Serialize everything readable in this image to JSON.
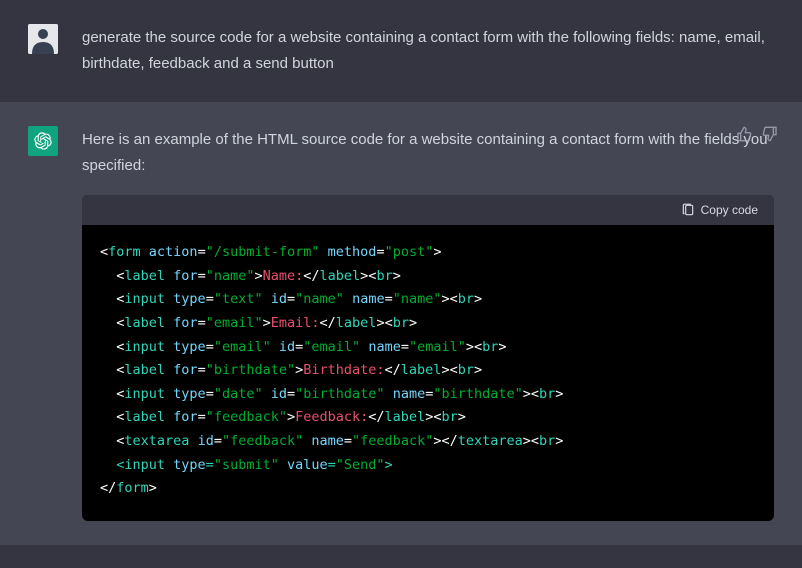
{
  "user": {
    "text": "generate the source code for a website containing a contact form with the following fields: name, email, birthdate, feedback and a send button"
  },
  "assistant": {
    "intro": "Here is an example of the HTML source code for a website containing a contact form with the fields you specified:",
    "copy_label": "Copy code",
    "code_tokens": [
      [
        [
          "punc",
          "<"
        ],
        [
          "tag",
          "form"
        ],
        [
          "punc",
          " "
        ],
        [
          "attr",
          "action"
        ],
        [
          "punc",
          "="
        ],
        [
          "str",
          "\"/submit-form\""
        ],
        [
          "punc",
          " "
        ],
        [
          "attr",
          "method"
        ],
        [
          "punc",
          "="
        ],
        [
          "str",
          "\"post\""
        ],
        [
          "punc",
          ">"
        ]
      ],
      [
        [
          "punc",
          "  <"
        ],
        [
          "tag",
          "label"
        ],
        [
          "punc",
          " "
        ],
        [
          "attr",
          "for"
        ],
        [
          "punc",
          "="
        ],
        [
          "str",
          "\"name\""
        ],
        [
          "punc",
          ">"
        ],
        [
          "text",
          "Name:"
        ],
        [
          "punc",
          "</"
        ],
        [
          "tag",
          "label"
        ],
        [
          "punc",
          "><"
        ],
        [
          "tag",
          "br"
        ],
        [
          "punc",
          ">"
        ]
      ],
      [
        [
          "punc",
          "  <"
        ],
        [
          "tag",
          "input"
        ],
        [
          "punc",
          " "
        ],
        [
          "attr",
          "type"
        ],
        [
          "punc",
          "="
        ],
        [
          "str",
          "\"text\""
        ],
        [
          "punc",
          " "
        ],
        [
          "attr",
          "id"
        ],
        [
          "punc",
          "="
        ],
        [
          "str",
          "\"name\""
        ],
        [
          "punc",
          " "
        ],
        [
          "attr",
          "name"
        ],
        [
          "punc",
          "="
        ],
        [
          "str",
          "\"name\""
        ],
        [
          "punc",
          "><"
        ],
        [
          "tag",
          "br"
        ],
        [
          "punc",
          ">"
        ]
      ],
      [
        [
          "punc",
          "  <"
        ],
        [
          "tag",
          "label"
        ],
        [
          "punc",
          " "
        ],
        [
          "attr",
          "for"
        ],
        [
          "punc",
          "="
        ],
        [
          "str",
          "\"email\""
        ],
        [
          "punc",
          ">"
        ],
        [
          "text",
          "Email:"
        ],
        [
          "punc",
          "</"
        ],
        [
          "tag",
          "label"
        ],
        [
          "punc",
          "><"
        ],
        [
          "tag",
          "br"
        ],
        [
          "punc",
          ">"
        ]
      ],
      [
        [
          "punc",
          "  <"
        ],
        [
          "tag",
          "input"
        ],
        [
          "punc",
          " "
        ],
        [
          "attr",
          "type"
        ],
        [
          "punc",
          "="
        ],
        [
          "str",
          "\"email\""
        ],
        [
          "punc",
          " "
        ],
        [
          "attr",
          "id"
        ],
        [
          "punc",
          "="
        ],
        [
          "str",
          "\"email\""
        ],
        [
          "punc",
          " "
        ],
        [
          "attr",
          "name"
        ],
        [
          "punc",
          "="
        ],
        [
          "str",
          "\"email\""
        ],
        [
          "punc",
          "><"
        ],
        [
          "tag",
          "br"
        ],
        [
          "punc",
          ">"
        ]
      ],
      [
        [
          "punc",
          "  <"
        ],
        [
          "tag",
          "label"
        ],
        [
          "punc",
          " "
        ],
        [
          "attr",
          "for"
        ],
        [
          "punc",
          "="
        ],
        [
          "str",
          "\"birthdate\""
        ],
        [
          "punc",
          ">"
        ],
        [
          "text",
          "Birthdate:"
        ],
        [
          "punc",
          "</"
        ],
        [
          "tag",
          "label"
        ],
        [
          "punc",
          "><"
        ],
        [
          "tag",
          "br"
        ],
        [
          "punc",
          ">"
        ]
      ],
      [
        [
          "punc",
          "  <"
        ],
        [
          "tag",
          "input"
        ],
        [
          "punc",
          " "
        ],
        [
          "attr",
          "type"
        ],
        [
          "punc",
          "="
        ],
        [
          "str",
          "\"date\""
        ],
        [
          "punc",
          " "
        ],
        [
          "attr",
          "id"
        ],
        [
          "punc",
          "="
        ],
        [
          "str",
          "\"birthdate\""
        ],
        [
          "punc",
          " "
        ],
        [
          "attr",
          "name"
        ],
        [
          "punc",
          "="
        ],
        [
          "str",
          "\"birthdate\""
        ],
        [
          "punc",
          "><"
        ],
        [
          "tag",
          "br"
        ],
        [
          "punc",
          ">"
        ]
      ],
      [
        [
          "punc",
          "  <"
        ],
        [
          "tag",
          "label"
        ],
        [
          "punc",
          " "
        ],
        [
          "attr",
          "for"
        ],
        [
          "punc",
          "="
        ],
        [
          "str",
          "\"feedback\""
        ],
        [
          "punc",
          ">"
        ],
        [
          "text",
          "Feedback:"
        ],
        [
          "punc",
          "</"
        ],
        [
          "tag",
          "label"
        ],
        [
          "punc",
          "><"
        ],
        [
          "tag",
          "br"
        ],
        [
          "punc",
          ">"
        ]
      ],
      [
        [
          "punc",
          "  <"
        ],
        [
          "tag",
          "textarea"
        ],
        [
          "punc",
          " "
        ],
        [
          "attr",
          "id"
        ],
        [
          "punc",
          "="
        ],
        [
          "str",
          "\"feedback\""
        ],
        [
          "punc",
          " "
        ],
        [
          "attr",
          "name"
        ],
        [
          "punc",
          "="
        ],
        [
          "str",
          "\"feedback\""
        ],
        [
          "punc",
          "></"
        ],
        [
          "tag",
          "textarea"
        ],
        [
          "punc",
          "><"
        ],
        [
          "tag",
          "br"
        ],
        [
          "punc",
          ">"
        ]
      ],
      [
        [
          "tag",
          "  <input "
        ],
        [
          "attr",
          "type"
        ],
        [
          "tag",
          "="
        ],
        [
          "str",
          "\"submit\""
        ],
        [
          "tag",
          " "
        ],
        [
          "attr",
          "value"
        ],
        [
          "tag",
          "="
        ],
        [
          "str",
          "\"Send\""
        ],
        [
          "tag",
          ">"
        ]
      ],
      [
        [
          "punc",
          "</"
        ],
        [
          "tag",
          "form"
        ],
        [
          "punc",
          ">"
        ]
      ]
    ]
  }
}
